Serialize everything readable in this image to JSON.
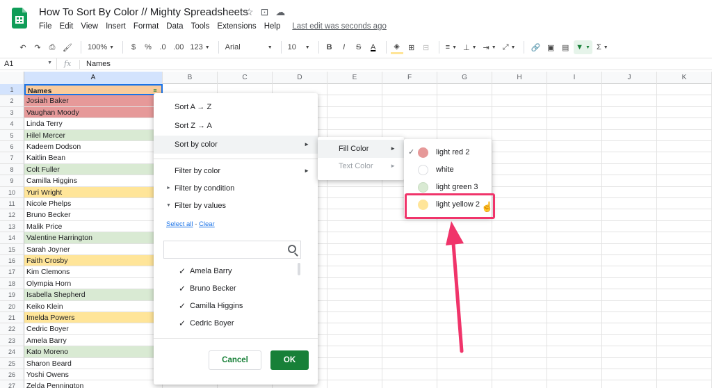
{
  "app": {
    "doc_title": "How To Sort By Color // Mighty Spreadsheets",
    "menu": [
      "File",
      "Edit",
      "View",
      "Insert",
      "Format",
      "Data",
      "Tools",
      "Extensions",
      "Help"
    ],
    "last_edit": "Last edit was seconds ago",
    "icons": [
      "star-icon",
      "move-folder-icon",
      "cloud-status-icon"
    ]
  },
  "toolbar": {
    "zoom": "100%",
    "currency": "$",
    "percent": "%",
    "dec_decrease": ".0",
    "dec_increase": ".00",
    "number_format": "123",
    "font_name": "Arial",
    "font_size": "10",
    "bold": "B",
    "italic": "I",
    "strike": "S",
    "text_color": "A",
    "sigma": "Σ",
    "filter_color": "#188038"
  },
  "formula_bar": {
    "cell_ref": "A1",
    "fx": "fx",
    "value": "Names"
  },
  "columns": [
    "A",
    "B",
    "C",
    "D",
    "E",
    "F",
    "G",
    "H",
    "I",
    "J",
    "K"
  ],
  "rows": [
    {
      "num": "1",
      "value": "Names",
      "fill": "#f9cb9c"
    },
    {
      "num": "2",
      "value": "Josiah Baker",
      "fill": "#e69999"
    },
    {
      "num": "3",
      "value": "Vaughan Moody",
      "fill": "#e69999"
    },
    {
      "num": "4",
      "value": "Linda Terry",
      "fill": "#ffffff"
    },
    {
      "num": "5",
      "value": "Hilel Mercer",
      "fill": "#d9ead3"
    },
    {
      "num": "6",
      "value": "Kadeem Dodson",
      "fill": "#ffffff"
    },
    {
      "num": "7",
      "value": "Kaitlin Bean",
      "fill": "#ffffff"
    },
    {
      "num": "8",
      "value": "Colt Fuller",
      "fill": "#d9ead3"
    },
    {
      "num": "9",
      "value": "Camilla Higgins",
      "fill": "#ffffff"
    },
    {
      "num": "10",
      "value": "Yuri Wright",
      "fill": "#ffe599"
    },
    {
      "num": "11",
      "value": "Nicole Phelps",
      "fill": "#ffffff"
    },
    {
      "num": "12",
      "value": "Bruno Becker",
      "fill": "#ffffff"
    },
    {
      "num": "13",
      "value": "Malik Price",
      "fill": "#ffffff"
    },
    {
      "num": "14",
      "value": "Valentine Harrington",
      "fill": "#d9ead3"
    },
    {
      "num": "15",
      "value": "Sarah Joyner",
      "fill": "#ffffff"
    },
    {
      "num": "16",
      "value": "Faith Crosby",
      "fill": "#ffe599"
    },
    {
      "num": "17",
      "value": "Kim Clemons",
      "fill": "#ffffff"
    },
    {
      "num": "18",
      "value": "Olympia Horn",
      "fill": "#ffffff"
    },
    {
      "num": "19",
      "value": "Isabella Shepherd",
      "fill": "#d9ead3"
    },
    {
      "num": "20",
      "value": "Keiko Klein",
      "fill": "#ffffff"
    },
    {
      "num": "21",
      "value": "Imelda Powers",
      "fill": "#ffe599"
    },
    {
      "num": "22",
      "value": "Cedric Boyer",
      "fill": "#ffffff"
    },
    {
      "num": "23",
      "value": "Amela Barry",
      "fill": "#ffffff"
    },
    {
      "num": "24",
      "value": "Kato Moreno",
      "fill": "#d9ead3"
    },
    {
      "num": "25",
      "value": "Sharon Beard",
      "fill": "#ffffff"
    },
    {
      "num": "26",
      "value": "Yoshi Owens",
      "fill": "#ffffff"
    },
    {
      "num": "27",
      "value": "Zelda Pennington",
      "fill": "#ffffff"
    }
  ],
  "filter_menu": {
    "sort_az": "Sort A → Z",
    "sort_za": "Sort Z → A",
    "sort_by_color": "Sort by color",
    "filter_by_color": "Filter by color",
    "filter_by_condition": "Filter by condition",
    "filter_by_values": "Filter by values",
    "select_all": "Select all",
    "dash": " - ",
    "clear": "Clear",
    "search_placeholder": "",
    "values": [
      "Amela Barry",
      "Bruno Becker",
      "Camilla Higgins",
      "Cedric Boyer"
    ],
    "cancel": "Cancel",
    "ok": "OK"
  },
  "sort_color_submenu": {
    "fill_color": "Fill Color",
    "text_color": "Text Color"
  },
  "fill_color_options": [
    {
      "label": "light red 2",
      "color": "#e69999",
      "checked": true
    },
    {
      "label": "white",
      "color": "#ffffff",
      "checked": false
    },
    {
      "label": "light green 3",
      "color": "#d9ead3",
      "checked": false
    },
    {
      "label": "light yellow 2",
      "color": "#ffe599",
      "checked": false
    }
  ],
  "accent": {
    "highlight": "#f0346a",
    "ok_button": "#188038",
    "selection": "#1a73e8"
  }
}
